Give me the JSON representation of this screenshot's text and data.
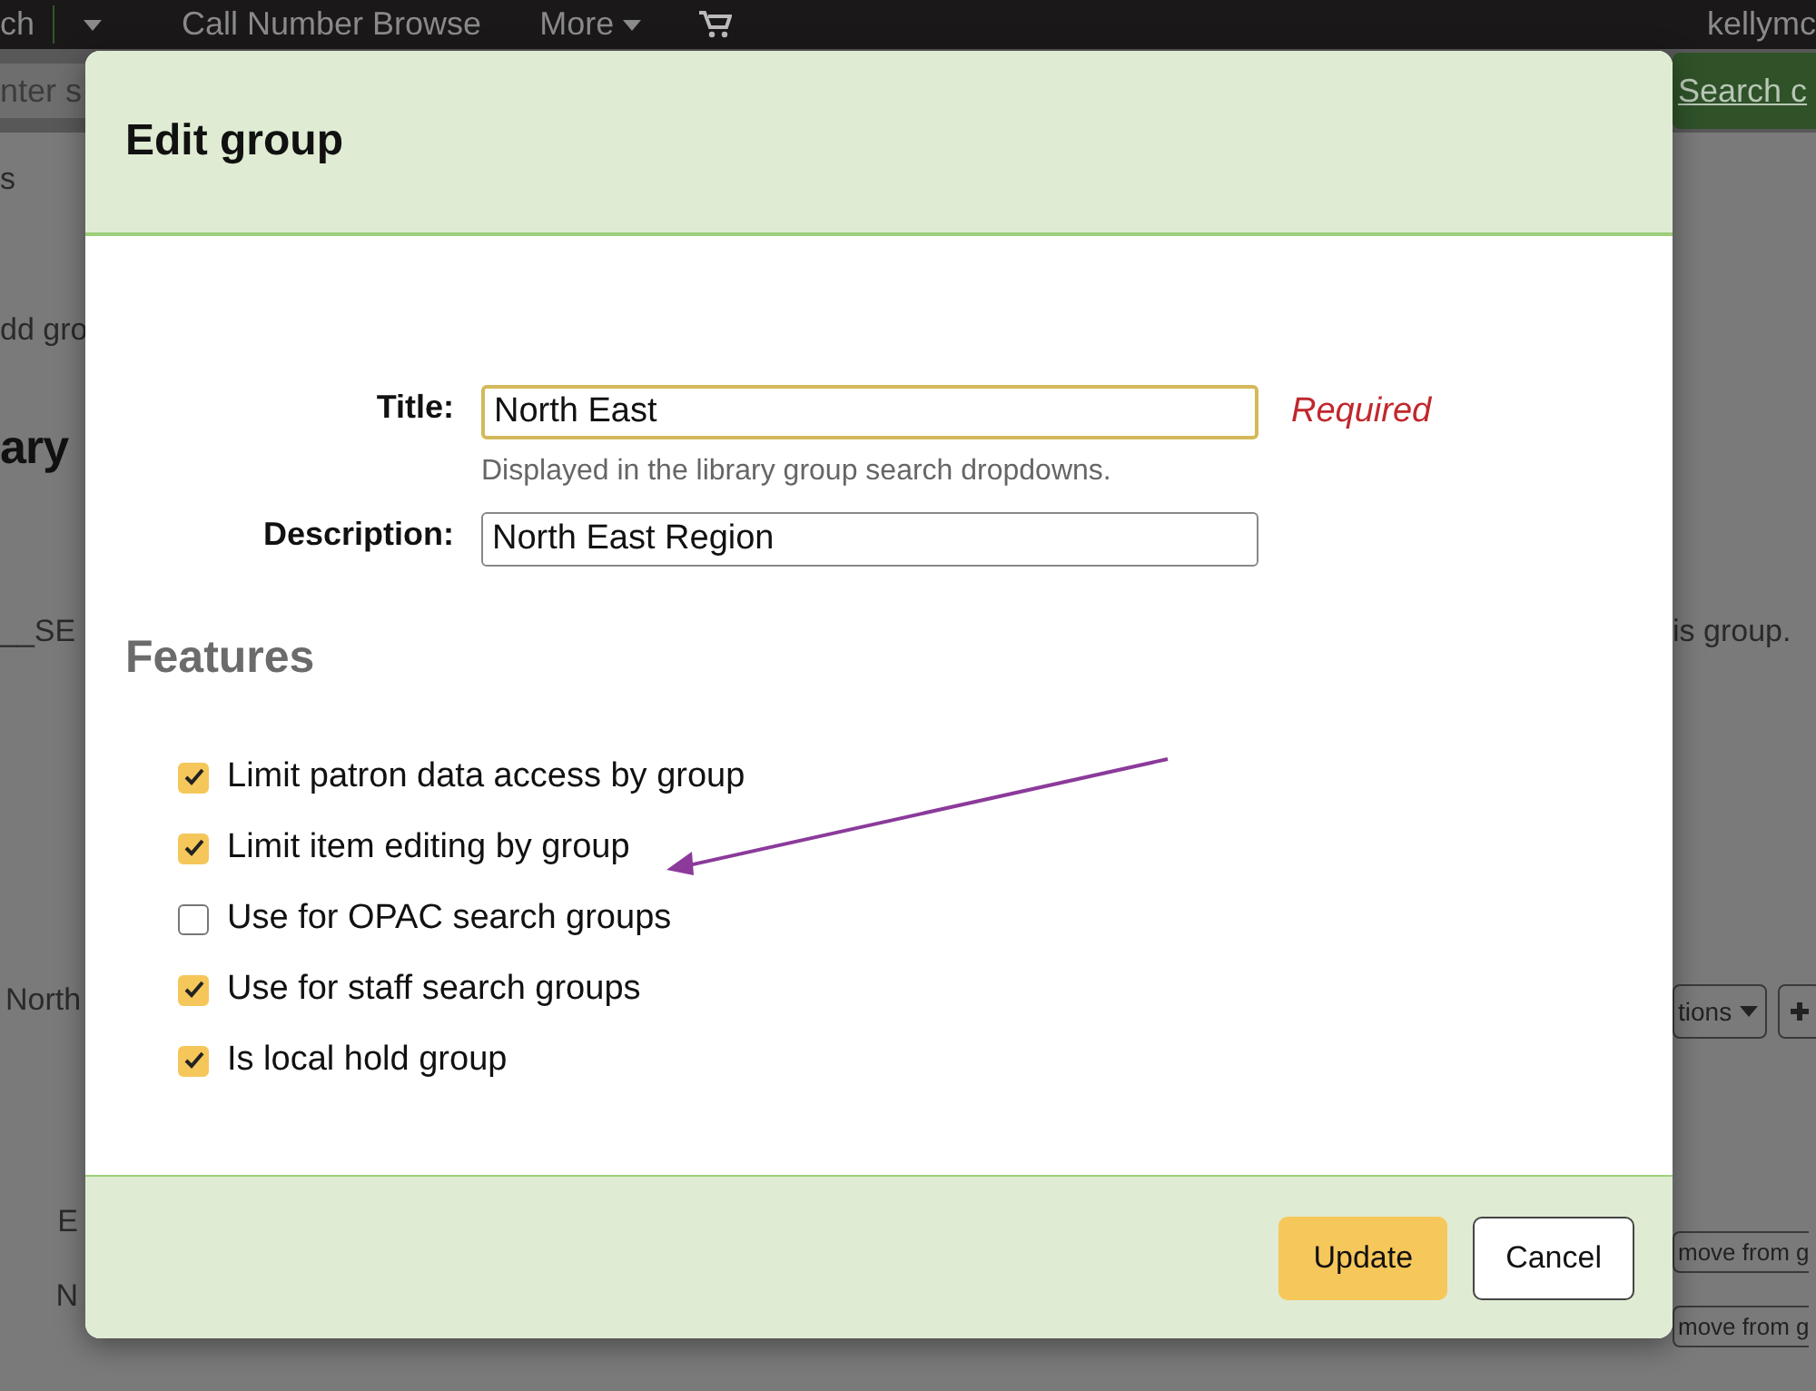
{
  "background_page": {
    "nav_items": [
      {
        "kind": "text",
        "label": "ch"
      },
      {
        "kind": "caret"
      },
      {
        "kind": "text",
        "label": "Call Number Browse"
      },
      {
        "kind": "menu",
        "label": "More"
      },
      {
        "kind": "cart"
      }
    ],
    "user": "kellymc",
    "search": {
      "placeholder": "nter s",
      "button": "Search c"
    },
    "left_fragments": [
      {
        "kind": "text",
        "text": "s"
      },
      {
        "kind": "text",
        "text": "dd gro"
      },
      {
        "kind": "heading",
        "text": "ary"
      },
      {
        "kind": "text",
        "text": "__SE"
      },
      {
        "kind": "text",
        "text": "North"
      },
      {
        "kind": "cell",
        "text": "E"
      },
      {
        "kind": "cell",
        "text": "N"
      }
    ],
    "right_fragments": [
      {
        "kind": "text",
        "label": "is group."
      },
      {
        "kind": "dropdown",
        "label": "tions"
      },
      {
        "kind": "button",
        "label": "move from g"
      },
      {
        "kind": "button",
        "label": "move from g"
      }
    ]
  },
  "modal": {
    "title": "Edit group",
    "fields": [
      {
        "label": "Title:",
        "value": "North East",
        "focused": true,
        "required": "Required",
        "hint": "Displayed in the library group search dropdowns."
      },
      {
        "label": "Description:",
        "value": "North East Region",
        "focused": false
      }
    ],
    "features": {
      "heading": "Features",
      "options": [
        {
          "label": "Limit patron data access by group",
          "checked": true
        },
        {
          "label": "Limit item editing by group",
          "checked": true
        },
        {
          "label": "Use for OPAC search groups",
          "checked": false
        },
        {
          "label": "Use for staff search groups",
          "checked": true
        },
        {
          "label": "Is local hold group",
          "checked": true
        }
      ]
    },
    "buttons": [
      {
        "label": "Update",
        "kind": "primary"
      },
      {
        "label": "Cancel",
        "kind": "default"
      }
    ]
  }
}
